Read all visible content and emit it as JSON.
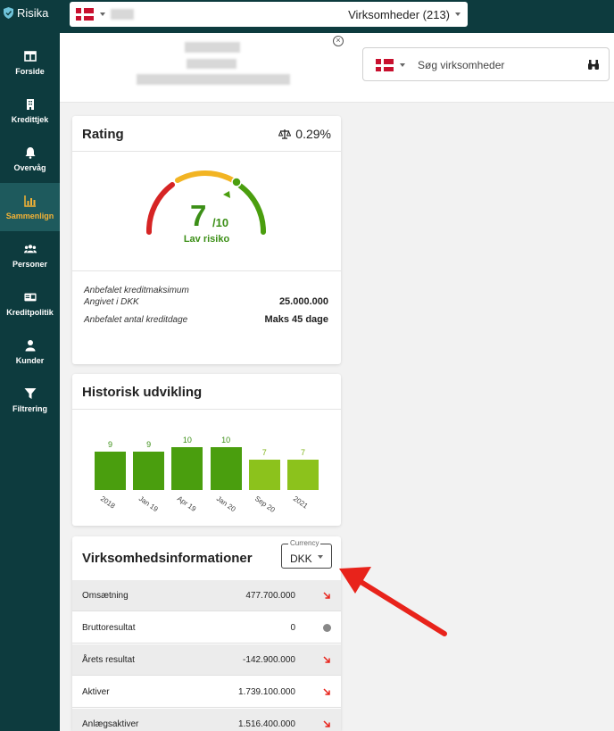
{
  "app": {
    "brand": "Risika"
  },
  "sidebar": {
    "items": [
      {
        "label": "Forside",
        "icon": "columns-icon"
      },
      {
        "label": "Kredittjek",
        "icon": "building-icon"
      },
      {
        "label": "Overvåg",
        "icon": "bell-icon"
      },
      {
        "label": "Sammenlign",
        "icon": "chart-icon",
        "active": true
      },
      {
        "label": "Personer",
        "icon": "people-icon"
      },
      {
        "label": "Kreditpolitik",
        "icon": "id-card-icon"
      },
      {
        "label": "Kunder",
        "icon": "user-icon"
      },
      {
        "label": "Filtrering",
        "icon": "filter-icon"
      }
    ]
  },
  "topbar": {
    "list_select": "Virksomheder (213)"
  },
  "search": {
    "placeholder": "Søg virksomheder"
  },
  "rating": {
    "title": "Rating",
    "probability": "0.29%",
    "score": "7",
    "score_max": "/10",
    "risk_label": "Lav risiko",
    "credit_max_label": "Anbefalet kreditmaksimum",
    "credit_max_sub": "Angivet i DKK",
    "credit_max_value": "25.000.000",
    "credit_days_label": "Anbefalet antal kreditdage",
    "credit_days_value": "Maks 45 dage"
  },
  "historic": {
    "title": "Historisk udvikling",
    "chart_data": {
      "type": "bar",
      "categories": [
        "2018",
        "Jan 19",
        "Apr 19",
        "Jan 20",
        "Sep 20",
        "2021"
      ],
      "values": [
        9,
        9,
        10,
        10,
        7,
        7
      ],
      "colors": [
        "#4a9e0e",
        "#4a9e0e",
        "#4a9e0e",
        "#4a9e0e",
        "#8cc21c",
        "#8cc21c"
      ]
    }
  },
  "company_info": {
    "title": "Virksomhedsinformationer",
    "currency_label": "Currency",
    "currency_value": "DKK",
    "rows": [
      {
        "label": "Omsætning",
        "value": "477.700.000",
        "trend": "down"
      },
      {
        "label": "Bruttoresultat",
        "value": "0",
        "trend": "neutral"
      },
      {
        "label": "Årets resultat",
        "value": "-142.900.000",
        "trend": "down"
      },
      {
        "label": "Aktiver",
        "value": "1.739.100.000",
        "trend": "down"
      },
      {
        "label": "Anlægsaktiver",
        "value": "1.516.400.000",
        "trend": "down"
      }
    ]
  },
  "colors": {
    "sidebar": "#0d3b3e",
    "accent": "#f5b335",
    "green": "#3c8f17",
    "red": "#e8231b"
  }
}
